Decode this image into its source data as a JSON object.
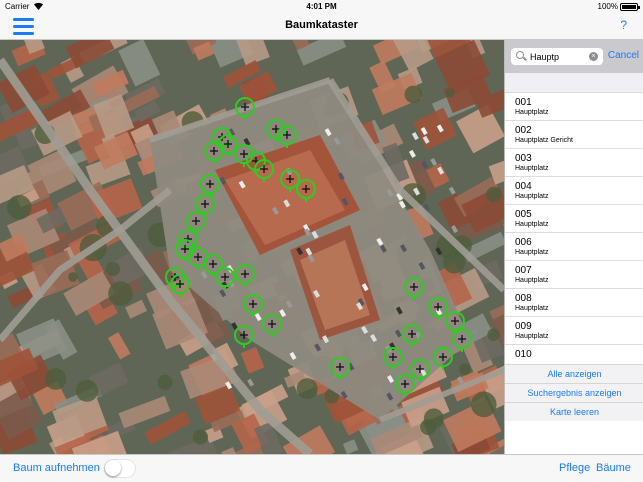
{
  "status_bar": {
    "carrier": "Carrier",
    "wifi_icon": "wifi-icon",
    "time": "4:01 PM",
    "battery": "100%"
  },
  "nav": {
    "title": "Baumkataster",
    "menu_icon": "hamburger-menu-icon",
    "help_label": "?"
  },
  "search": {
    "value": "Hauptp",
    "cancel_label": "Cancel"
  },
  "results": [
    {
      "id": "001",
      "location": "Hauptplatz"
    },
    {
      "id": "002",
      "location": "Hauptplatz Gericht"
    },
    {
      "id": "003",
      "location": "Hauptplatz"
    },
    {
      "id": "004",
      "location": "Hauptplatz"
    },
    {
      "id": "005",
      "location": "Hauptplatz"
    },
    {
      "id": "006",
      "location": "Hauptplatz"
    },
    {
      "id": "007",
      "location": "Hauptplatz"
    },
    {
      "id": "008",
      "location": "Hauptplatz"
    },
    {
      "id": "009",
      "location": "Hauptplatz"
    },
    {
      "id": "010",
      "location": ""
    }
  ],
  "actions": {
    "show_all": "Alle anzeigen",
    "show_results": "Suchergebnis anzeigen",
    "clear_map": "Karte leeren"
  },
  "toolbar": {
    "record_tree_label": "Baum aufnehmen",
    "record_toggle_on": false,
    "care_label": "Pflege",
    "trees_label": "Bäume"
  },
  "colors": {
    "accent": "#1a7cf0",
    "tree_marker": "#2ecc1f"
  }
}
